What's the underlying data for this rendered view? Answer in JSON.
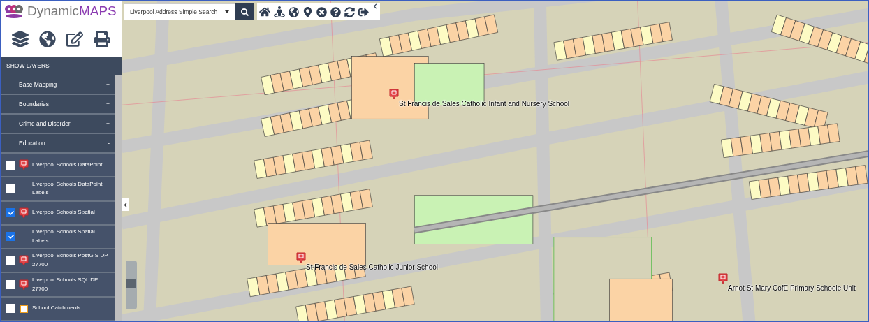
{
  "logo": {
    "text_plain": "Dynamic",
    "text_accent": "MAPS"
  },
  "search": {
    "value": "Liverpool Address Simple Search"
  },
  "sidebar": {
    "header": "SHOW LAYERS",
    "groups": [
      {
        "label": "Base Mapping",
        "toggle": "+"
      },
      {
        "label": "Boundaries",
        "toggle": "+"
      },
      {
        "label": "Crime and Disorder",
        "toggle": "+"
      },
      {
        "label": "Education",
        "toggle": "-"
      }
    ],
    "layers": [
      {
        "label": "Liverpool Schools DataPoint",
        "checked": false,
        "kind": "school"
      },
      {
        "label": "Liverpool Schools DataPoint Labels",
        "checked": false,
        "kind": "none"
      },
      {
        "label": "Liverpool Schools Spatial",
        "checked": true,
        "kind": "school"
      },
      {
        "label": "Liverpool Schools Spatial Labels",
        "checked": true,
        "kind": "none"
      },
      {
        "label": "Liverpool Schools PostGIS DP 27700",
        "checked": false,
        "kind": "school"
      },
      {
        "label": "Liverpool Schools SQL DP 27700",
        "checked": false,
        "kind": "school"
      },
      {
        "label": "School Catchments",
        "checked": false,
        "kind": "catchment"
      }
    ]
  },
  "map": {
    "labels": [
      {
        "text": "St Francis de Sales Catholic Infant and Nursery School"
      },
      {
        "text": "St Francis de Sales Catholic Junior School"
      },
      {
        "text": "Arnot St Mary CofE Primary Schoole Unit"
      }
    ]
  }
}
